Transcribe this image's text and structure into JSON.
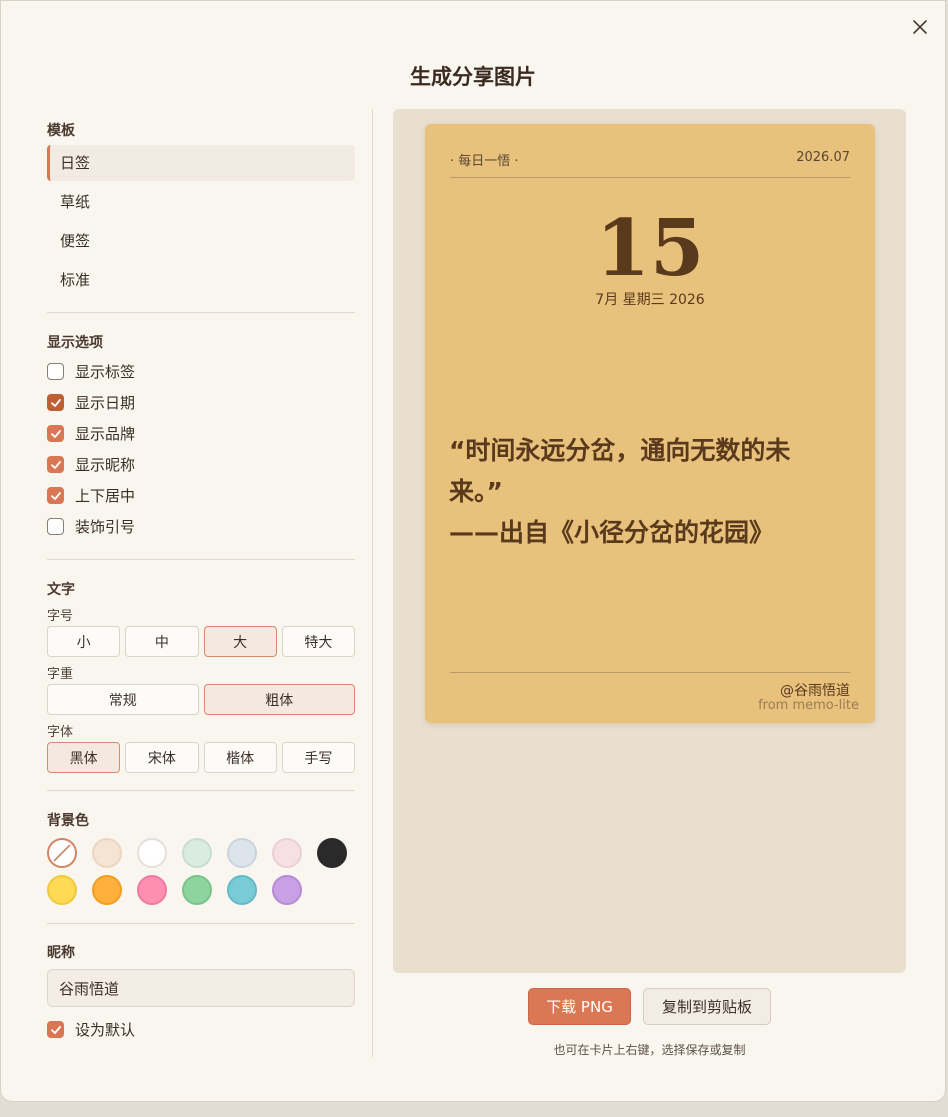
{
  "dialog": {
    "title": "生成分享图片"
  },
  "template": {
    "section_title": "模板",
    "items": [
      {
        "label": "日签",
        "active": true
      },
      {
        "label": "草纸",
        "active": false
      },
      {
        "label": "便签",
        "active": false
      },
      {
        "label": "标准",
        "active": false
      }
    ]
  },
  "display_options": {
    "section_title": "显示选项",
    "items": [
      {
        "label": "显示标签",
        "checked": false
      },
      {
        "label": "显示日期",
        "checked": true
      },
      {
        "label": "显示品牌",
        "checked": true
      },
      {
        "label": "显示昵称",
        "checked": true
      },
      {
        "label": "上下居中",
        "checked": true
      },
      {
        "label": "装饰引号",
        "checked": false
      }
    ]
  },
  "text": {
    "section_title": "文字",
    "size_label": "字号",
    "sizes": [
      {
        "label": "小",
        "active": false
      },
      {
        "label": "中",
        "active": false
      },
      {
        "label": "大",
        "active": true
      },
      {
        "label": "特大",
        "active": false
      }
    ],
    "weight_label": "字重",
    "weights": [
      {
        "label": "常规",
        "active": false
      },
      {
        "label": "粗体",
        "active": true
      }
    ],
    "font_label": "字体",
    "fonts": [
      {
        "label": "黑体",
        "active": true
      },
      {
        "label": "宋体",
        "active": false
      },
      {
        "label": "楷体",
        "active": false
      },
      {
        "label": "手写",
        "active": false
      }
    ]
  },
  "background": {
    "section_title": "背景色",
    "colors": [
      "none",
      "#f5e4d3",
      "#ffffff",
      "#d9ecde",
      "#dde4ec",
      "#f6e0e3",
      "#2a2a2a",
      "#ffda55",
      "#ffb03b",
      "#ff8fb3",
      "#8ed49e",
      "#79cbd8",
      "#c8a0e4"
    ]
  },
  "nickname": {
    "section_title": "昵称",
    "value": "谷雨悟道",
    "default_label": "设为默认",
    "default_checked": true
  },
  "card": {
    "header_left": "· 每日一悟 ·",
    "header_right": "2026.07",
    "day": "15",
    "date_line": "7月 星期三 2026",
    "quote_line1": "“时间永远分岔，通向无数的未",
    "quote_line2": "来。”",
    "quote_source": "——出自《小径分岔的花园》",
    "author": "@谷雨悟道",
    "brand": "from memo-lite",
    "bg_color": "#e8c17c"
  },
  "actions": {
    "download_label": "下载 PNG",
    "copy_label": "复制到剪贴板",
    "hint": "也可在卡片上右键，选择保存或复制"
  }
}
